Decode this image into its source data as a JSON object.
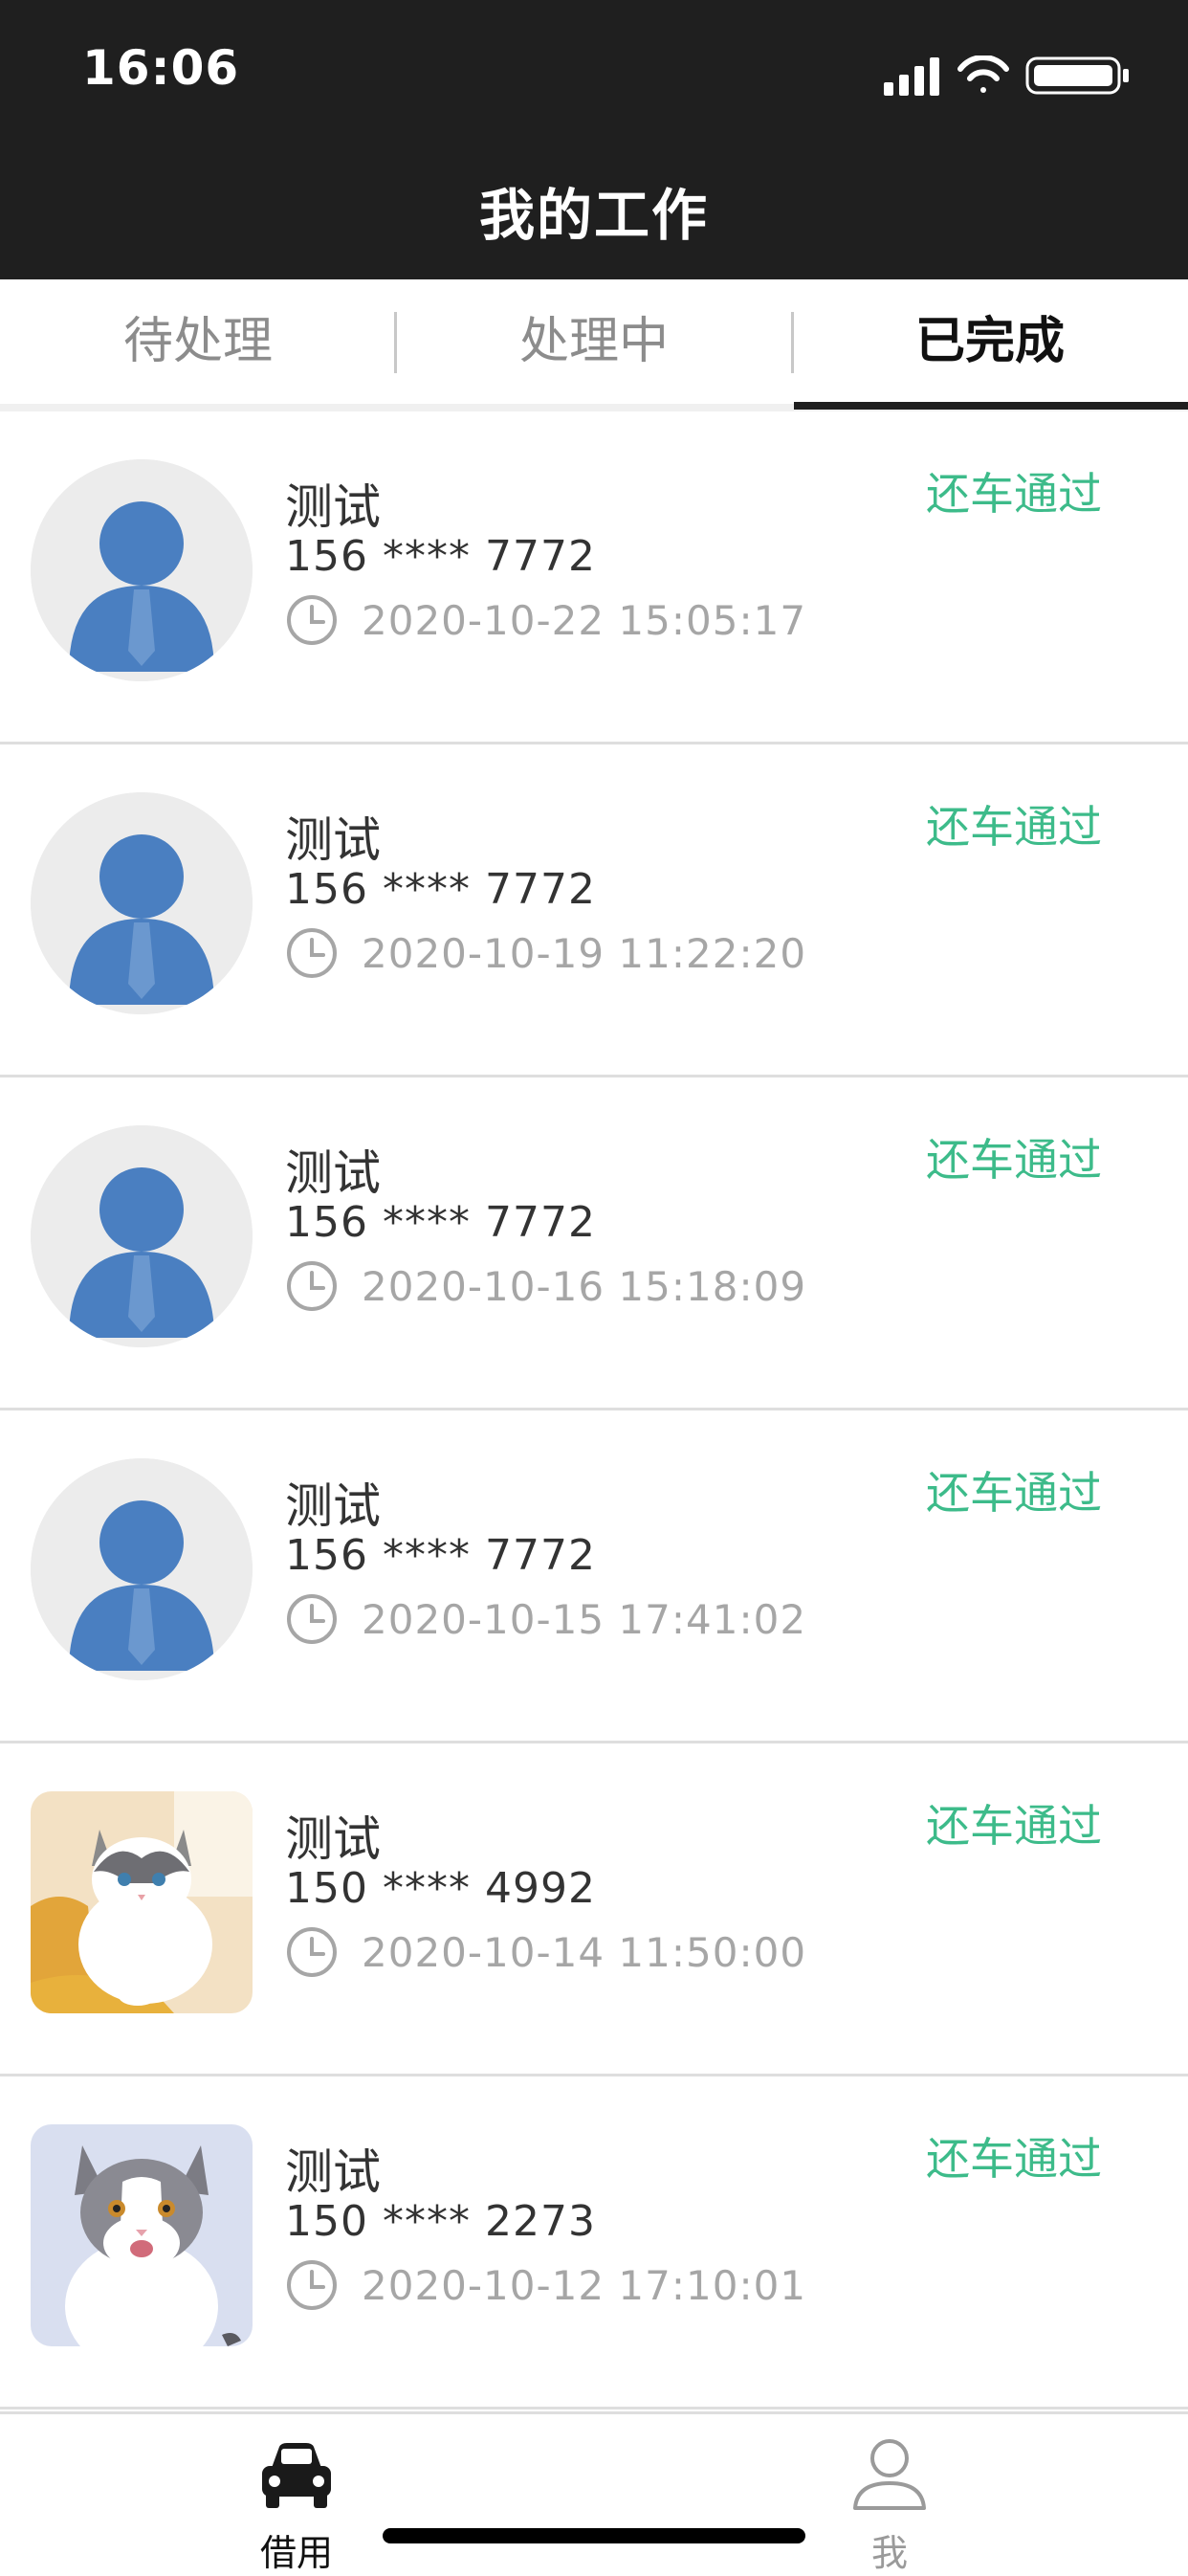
{
  "status_bar": {
    "time": "16:06"
  },
  "nav": {
    "title": "我的工作"
  },
  "tabs": [
    {
      "label": "待处理",
      "active": false
    },
    {
      "label": "处理中",
      "active": false
    },
    {
      "label": "已完成",
      "active": true
    }
  ],
  "records": [
    {
      "avatar": "default-person-avatar",
      "name": "测试",
      "phone": "156 **** 7772",
      "time": "2020-10-22 15:05:17",
      "status": "还车通过"
    },
    {
      "avatar": "default-person-avatar",
      "name": "测试",
      "phone": "156 **** 7772",
      "time": "2020-10-19 11:22:20",
      "status": "还车通过"
    },
    {
      "avatar": "default-person-avatar",
      "name": "测试",
      "phone": "156 **** 7772",
      "time": "2020-10-16 15:18:09",
      "status": "还车通过"
    },
    {
      "avatar": "default-person-avatar",
      "name": "测试",
      "phone": "156 **** 7772",
      "time": "2020-10-15 17:41:02",
      "status": "还车通过"
    },
    {
      "avatar": "cat-photo-avatar",
      "name": "测试",
      "phone": "150 **** 4992",
      "time": "2020-10-14 11:50:00",
      "status": "还车通过"
    },
    {
      "avatar": "cat-photo-avatar",
      "name": "测试",
      "phone": "150 **** 2273",
      "time": "2020-10-12 17:10:01",
      "status": "还车通过"
    }
  ],
  "bottom_nav": {
    "items": [
      {
        "label": "借用",
        "icon": "car-icon",
        "active": true
      },
      {
        "label": "我",
        "icon": "person-icon",
        "active": false
      }
    ]
  },
  "colors": {
    "header_bg": "#1f1f1f",
    "status_green": "#3dbb8a",
    "avatar_blue": "#4a7fc1"
  }
}
